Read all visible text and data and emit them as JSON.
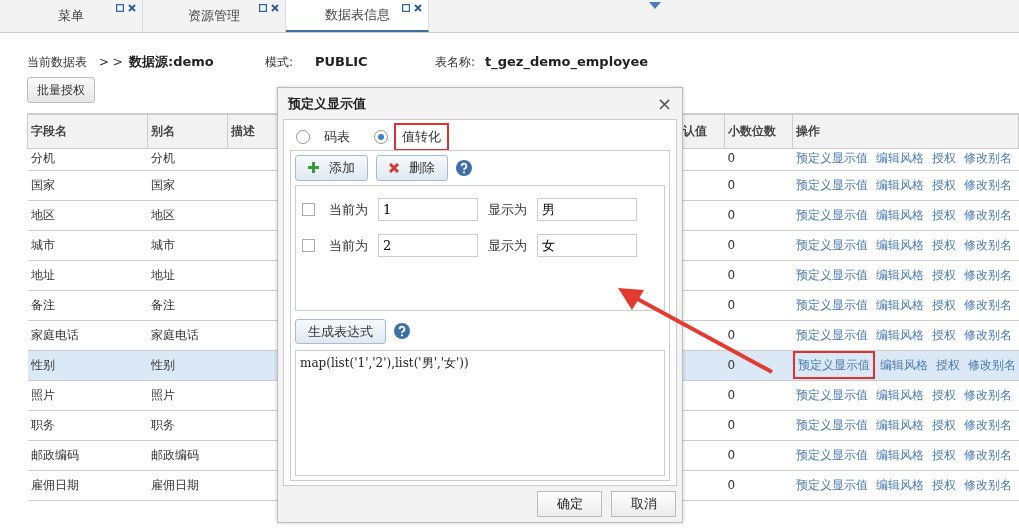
{
  "tabs": [
    {
      "label": "菜单",
      "selected": false
    },
    {
      "label": "资源管理",
      "selected": false
    },
    {
      "label": "数据表信息",
      "selected": true
    }
  ],
  "info": {
    "label": "当前数据表",
    "path_sep": "> >",
    "source": "数据源:demo",
    "schema_label": "模式:",
    "schema": "PUBLIC",
    "table_label": "表名称:",
    "table_name": "t_gez_demo_employee"
  },
  "batch_button": "批量授权",
  "table": {
    "columns": [
      "字段名",
      "别名",
      "描述",
      "认值",
      "小数位数",
      "操作"
    ],
    "rows": [
      {
        "field": "分机",
        "alias": "分机",
        "decimals": "0",
        "actions": [
          "预定义显示值",
          "编辑风格",
          "授权",
          "修改别名"
        ],
        "selected": false,
        "highlighted": false
      },
      {
        "field": "国家",
        "alias": "国家",
        "decimals": "0",
        "actions": [
          "预定义显示值",
          "编辑风格",
          "授权",
          "修改别名"
        ],
        "selected": false,
        "highlighted": false
      },
      {
        "field": "地区",
        "alias": "地区",
        "decimals": "0",
        "actions": [
          "预定义显示值",
          "编辑风格",
          "授权",
          "修改别名"
        ],
        "selected": false,
        "highlighted": false
      },
      {
        "field": "城市",
        "alias": "城市",
        "decimals": "0",
        "actions": [
          "预定义显示值",
          "编辑风格",
          "授权",
          "修改别名"
        ],
        "selected": false,
        "highlighted": false
      },
      {
        "field": "地址",
        "alias": "地址",
        "decimals": "0",
        "actions": [
          "预定义显示值",
          "编辑风格",
          "授权",
          "修改别名"
        ],
        "selected": false,
        "highlighted": false
      },
      {
        "field": "备注",
        "alias": "备注",
        "decimals": "0",
        "actions": [
          "预定义显示值",
          "编辑风格",
          "授权",
          "修改别名"
        ],
        "selected": false,
        "highlighted": false
      },
      {
        "field": "家庭电话",
        "alias": "家庭电话",
        "decimals": "0",
        "actions": [
          "预定义显示值",
          "编辑风格",
          "授权",
          "修改别名"
        ],
        "selected": false,
        "highlighted": false
      },
      {
        "field": "性别",
        "alias": "性别",
        "decimals": "0",
        "actions": [
          "预定义显示值",
          "编辑风格",
          "授权",
          "修改别名"
        ],
        "selected": true,
        "highlighted": true
      },
      {
        "field": "照片",
        "alias": "照片",
        "decimals": "0",
        "actions": [
          "预定义显示值",
          "编辑风格",
          "授权",
          "修改别名"
        ],
        "selected": false,
        "highlighted": false
      },
      {
        "field": "职务",
        "alias": "职务",
        "decimals": "0",
        "actions": [
          "预定义显示值",
          "编辑风格",
          "授权",
          "修改别名"
        ],
        "selected": false,
        "highlighted": false
      },
      {
        "field": "邮政编码",
        "alias": "邮政编码",
        "decimals": "0",
        "actions": [
          "预定义显示值",
          "编辑风格",
          "授权",
          "修改别名"
        ],
        "selected": false,
        "highlighted": false
      },
      {
        "field": "雇佣日期",
        "alias": "雇佣日期",
        "decimals": "0",
        "actions": [
          "预定义显示值",
          "编辑风格",
          "授权",
          "修改别名"
        ],
        "selected": false,
        "highlighted": false
      }
    ]
  },
  "dialog": {
    "title": "预定义显示值",
    "close": "×",
    "radios": [
      {
        "label": "码表",
        "selected": false,
        "callout": false
      },
      {
        "label": "值转化",
        "selected": true,
        "callout": true
      }
    ],
    "add_button": "添加",
    "delete_button": "删除",
    "mappings": [
      {
        "checked": false,
        "current_label": "当前为",
        "value": "1",
        "display_label": "显示为",
        "display": "男"
      },
      {
        "checked": false,
        "current_label": "当前为",
        "value": "2",
        "display_label": "显示为",
        "display": "女"
      }
    ],
    "generate_button": "生成表达式",
    "expression": "map(list('1','2'),list('男','女'))",
    "buttons": [
      "确定",
      "取消"
    ]
  }
}
